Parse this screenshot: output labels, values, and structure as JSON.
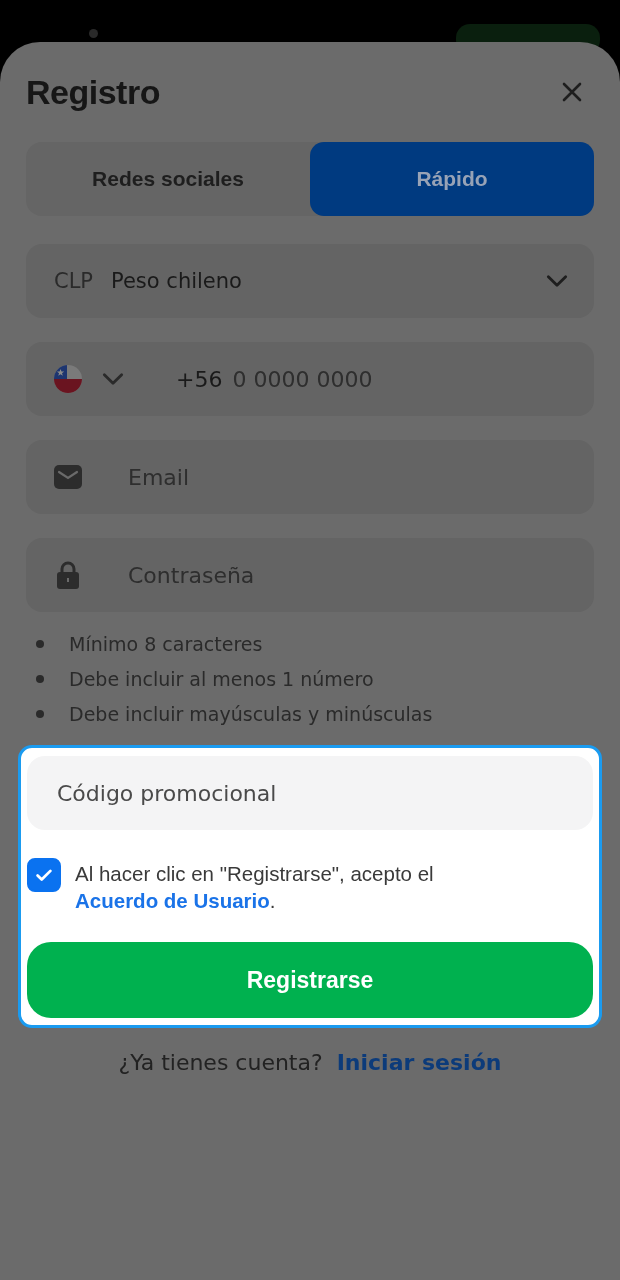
{
  "sheet": {
    "title": "Registro"
  },
  "tabs": [
    {
      "label": "Redes sociales",
      "selected": false
    },
    {
      "label": "Rápido",
      "selected": true
    }
  ],
  "currency": {
    "code": "CLP",
    "name": "Peso chileno"
  },
  "phone": {
    "code": "+56",
    "placeholder": "0 0000 0000"
  },
  "email": {
    "placeholder": "Email"
  },
  "password": {
    "placeholder": "Contraseña"
  },
  "password_rules": [
    "Mínimo 8 caracteres",
    "Debe incluir al menos 1 número",
    "Debe incluir mayúsculas y minúsculas"
  ],
  "highlighted": {
    "promo": {
      "placeholder": "Código promocional"
    },
    "agreement": {
      "checked": true,
      "text": "Al hacer clic en \"Registrarse\", acepto el",
      "link": "Acuerdo de Usuario",
      "end": "."
    },
    "submit": "Registrarse"
  },
  "login": {
    "prompt": "¿Ya tienes cuenta?",
    "link": "Iniciar sesión"
  }
}
